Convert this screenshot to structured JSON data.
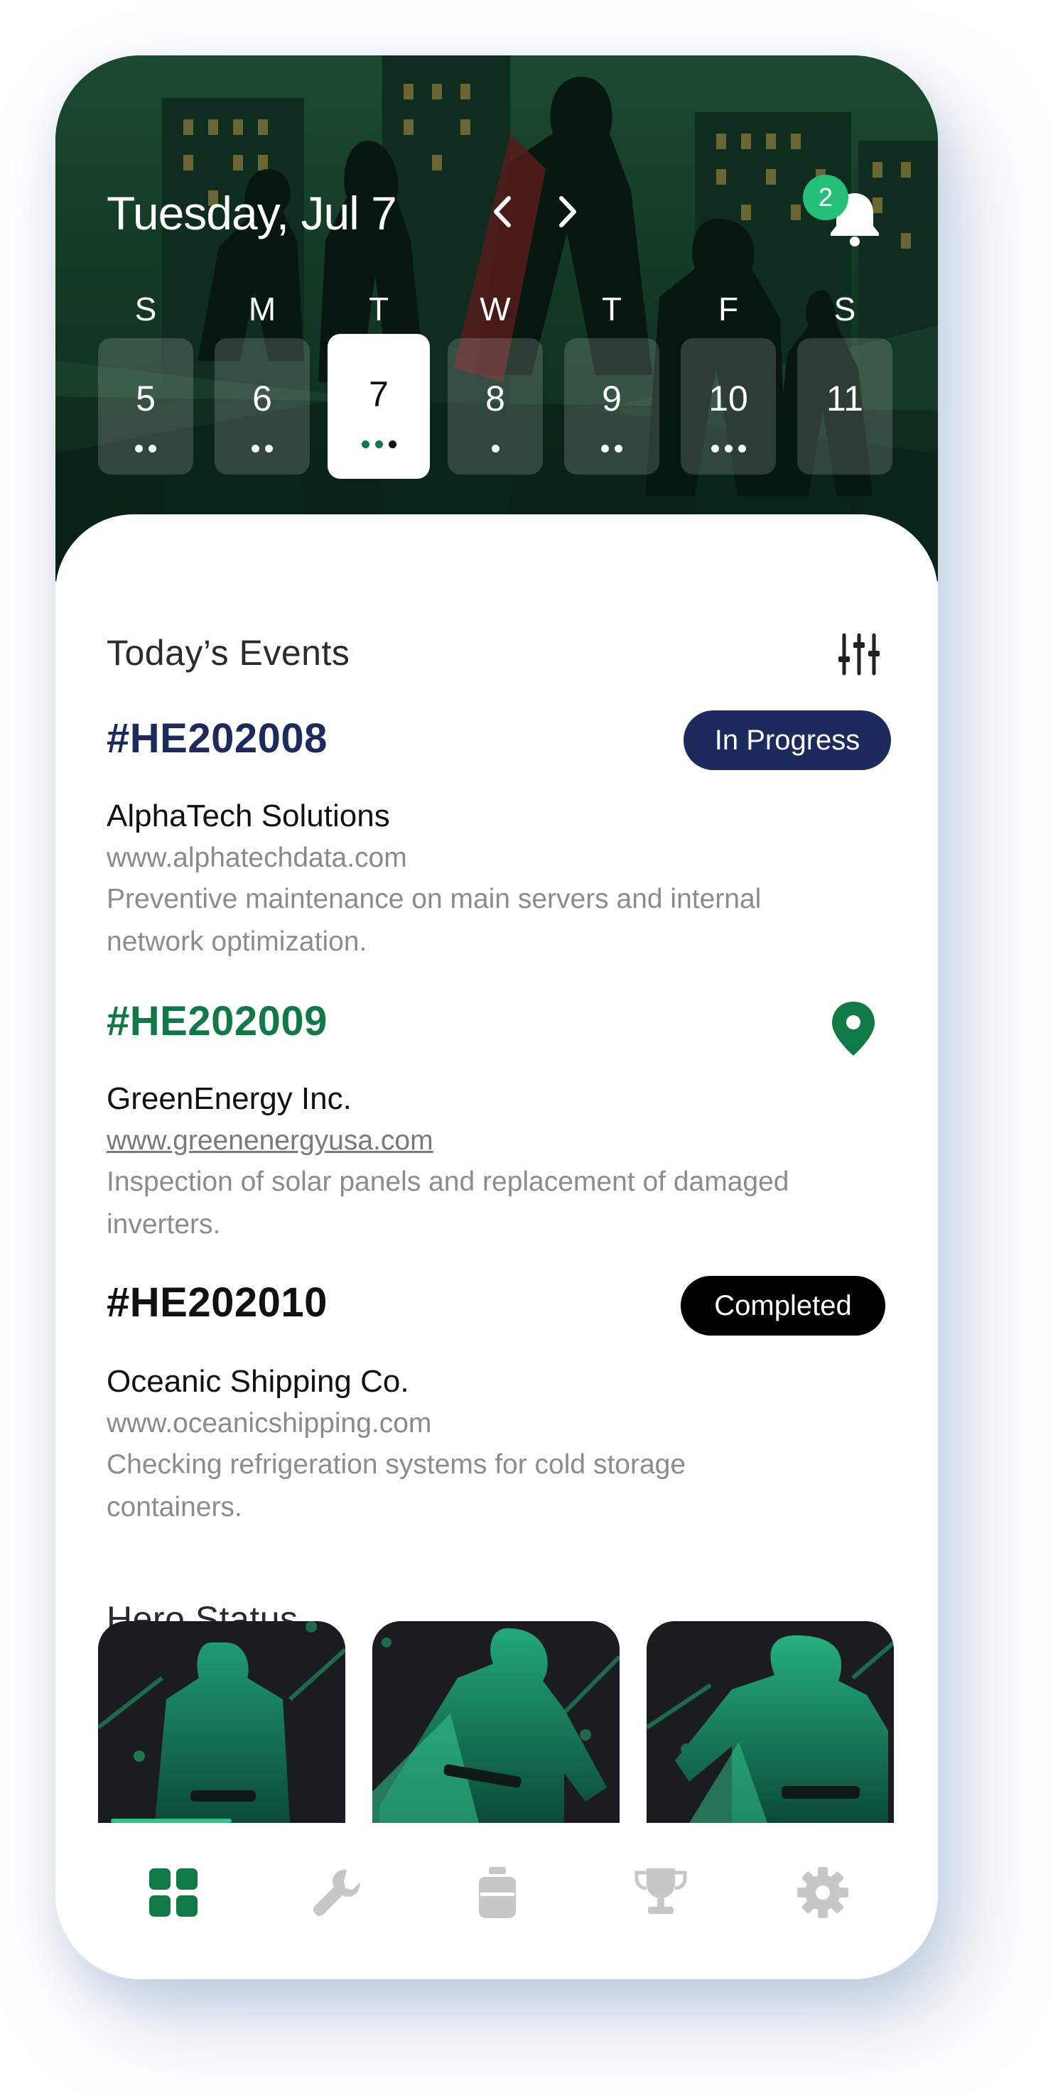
{
  "header": {
    "date_title": "Tuesday, Jul 7",
    "notifications_count": "2",
    "week": [
      {
        "label": "S",
        "day": "5",
        "dots": 2,
        "active": false
      },
      {
        "label": "M",
        "day": "6",
        "dots": 2,
        "active": false
      },
      {
        "label": "T",
        "day": "7",
        "dots": 3,
        "active": true
      },
      {
        "label": "W",
        "day": "8",
        "dots": 1,
        "active": false
      },
      {
        "label": "T",
        "day": "9",
        "dots": 2,
        "active": false
      },
      {
        "label": "F",
        "day": "10",
        "dots": 3,
        "active": false
      },
      {
        "label": "S",
        "day": "11",
        "dots": 0,
        "active": false
      }
    ]
  },
  "events_section": {
    "title": "Today’s Events",
    "events": [
      {
        "id": "#HE202008",
        "company": "AlphaTech Solutions",
        "url": "www.alphatechdata.com",
        "description": "Preventive maintenance on main servers and internal network optimization.",
        "status": "In Progress",
        "id_color": "#1d2a5e"
      },
      {
        "id": "#HE202009",
        "company": "GreenEnergy Inc.",
        "url": "www.greenenergyusa.com",
        "description": "Inspection of solar panels and replacement of damaged inverters.",
        "status": "",
        "id_color": "#0f7a45"
      },
      {
        "id": "#HE202010",
        "company": "Oceanic Shipping Co.",
        "url": "www.oceanicshipping.com",
        "description": "Checking refrigeration systems for cold storage containers.",
        "status": "Completed",
        "id_color": "#111111"
      }
    ]
  },
  "hero_section": {
    "title": "Hero Status"
  },
  "tabbar": {
    "tabs": [
      "dashboard-icon",
      "wrench-icon",
      "gas-cylinder-icon",
      "trophy-icon",
      "gear-icon"
    ],
    "active_index": 0
  },
  "colors": {
    "accent": "#0f7a45",
    "in_progress": "#1d2a5e",
    "completed": "#000000",
    "badge": "#24c07a"
  }
}
